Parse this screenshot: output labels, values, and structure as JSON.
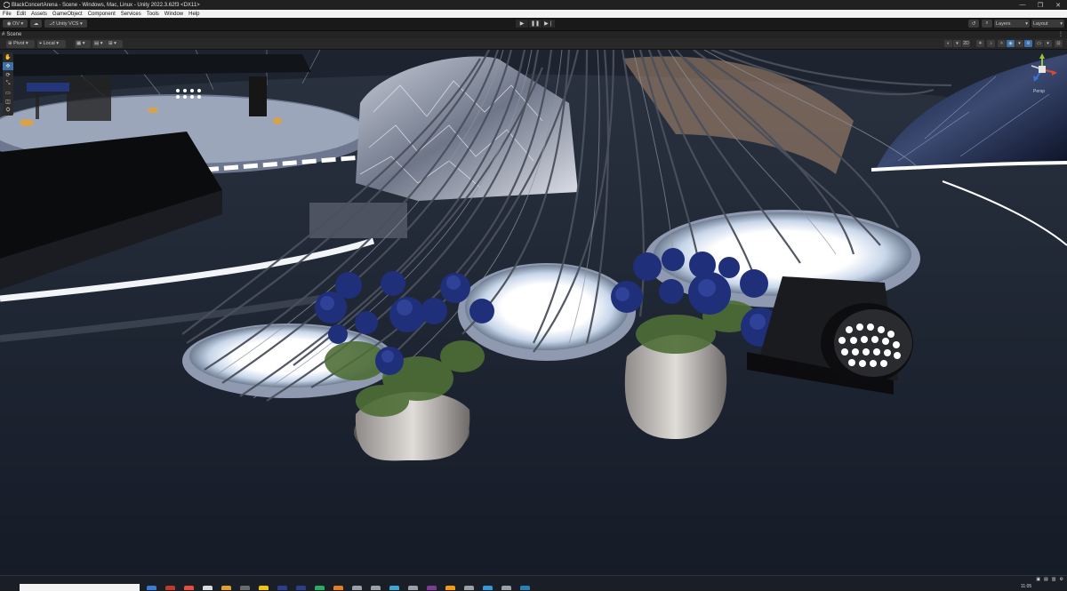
{
  "window": {
    "title": "BlackConcertArena - Scene - Windows, Mac, Linux - Unity 2022.3.62f3 <DX11>",
    "controls": [
      "—",
      "❐",
      "✕"
    ]
  },
  "menu": [
    "File",
    "Edit",
    "Assets",
    "GameObject",
    "Component",
    "Services",
    "Tools",
    "Window",
    "Help"
  ],
  "toolbar": {
    "account": "OV",
    "vcs": "Unity VCS",
    "layers": "Layers",
    "layout": "Layout",
    "play_icons": [
      "▶",
      "❚❚",
      "▶❘"
    ]
  },
  "tab": {
    "label": "Scene",
    "more": "⋮"
  },
  "scene_toolbar": {
    "pivot": "Pivot",
    "space": "Local",
    "camera_mode": "Persp"
  },
  "tools": [
    "✋",
    "✥",
    "⟳",
    "⤡",
    "▭",
    "◫",
    "⛭"
  ],
  "taskbar": {
    "clock": "11:05"
  },
  "colors": {
    "accent": "#3d6fa8",
    "titlebar": "#202020",
    "viewport_floor": "#1a2230"
  }
}
